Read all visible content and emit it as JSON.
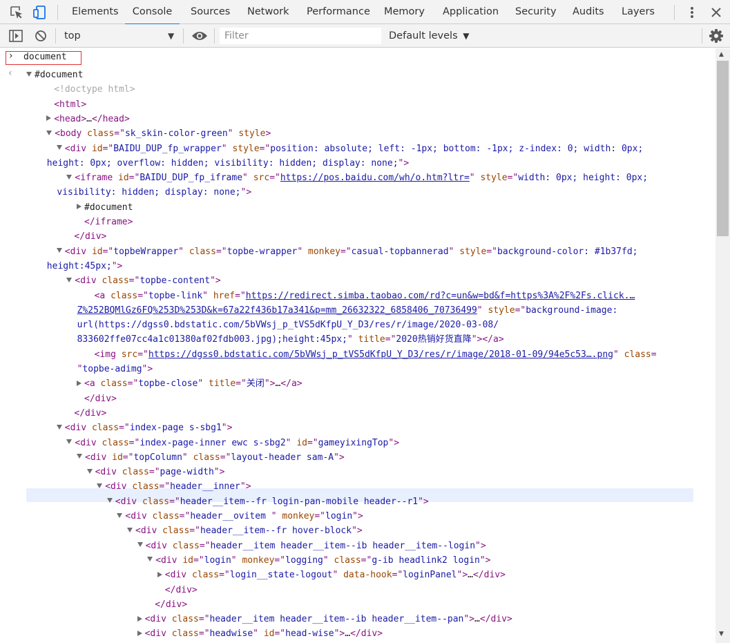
{
  "tabs": [
    {
      "label": "Elements",
      "active": false
    },
    {
      "label": "Console",
      "active": true
    },
    {
      "label": "Sources",
      "active": false
    },
    {
      "label": "Network",
      "active": false
    },
    {
      "label": "Performance",
      "active": false
    },
    {
      "label": "Memory",
      "active": false
    },
    {
      "label": "Application",
      "active": false
    },
    {
      "label": "Security",
      "active": false
    },
    {
      "label": "Audits",
      "active": false
    },
    {
      "label": "Layers",
      "active": false
    }
  ],
  "toolbar": {
    "context": "top",
    "filter_placeholder": "Filter",
    "levels": "Default levels"
  },
  "console": {
    "input": "document",
    "lines": [
      {
        "indent": 0,
        "tri": "down",
        "parts": [
          [
            "plain",
            "#document"
          ]
        ]
      },
      {
        "indent": 2,
        "tri": null,
        "parts": [
          [
            "comment",
            "<!doctype html>"
          ]
        ]
      },
      {
        "indent": 2,
        "tri": null,
        "parts": [
          [
            "tag",
            "<html>"
          ]
        ]
      },
      {
        "indent": 2,
        "tri": "right",
        "parts": [
          [
            "tag",
            "<head>"
          ],
          [
            "plain",
            "…"
          ],
          [
            "tag",
            "</head>"
          ]
        ]
      },
      {
        "indent": 2,
        "tri": "down",
        "parts": [
          [
            "tag",
            "<body "
          ],
          [
            "an",
            "class"
          ],
          [
            "tag",
            "=\""
          ],
          [
            "av",
            "sk_skin-color-green"
          ],
          [
            "tag",
            "\" "
          ],
          [
            "an",
            "style"
          ],
          [
            "tag",
            ">"
          ]
        ]
      },
      {
        "indent": 3,
        "tri": "down",
        "parts": [
          [
            "tag",
            "<div "
          ],
          [
            "an",
            "id"
          ],
          [
            "tag",
            "=\""
          ],
          [
            "av",
            "BAIDU_DUP_fp_wrapper"
          ],
          [
            "tag",
            "\" "
          ],
          [
            "an",
            "style"
          ],
          [
            "tag",
            "=\""
          ],
          [
            "av",
            "position: absolute; left: -1px; bottom: -1px; z-index: 0; width: 0px;"
          ]
        ]
      },
      {
        "indent": 3,
        "tri": null,
        "cont": true,
        "parts": [
          [
            "av",
            "height: 0px; overflow: hidden; visibility: hidden; display: none;"
          ],
          [
            "tag",
            "\">"
          ]
        ]
      },
      {
        "indent": 4,
        "tri": "down",
        "parts": [
          [
            "tag",
            "<iframe "
          ],
          [
            "an",
            "id"
          ],
          [
            "tag",
            "=\""
          ],
          [
            "av",
            "BAIDU_DUP_fp_iframe"
          ],
          [
            "tag",
            "\" "
          ],
          [
            "an",
            "src"
          ],
          [
            "tag",
            "=\""
          ],
          [
            "link",
            "https://pos.baidu.com/wh/o.htm?ltr="
          ],
          [
            "tag",
            "\" "
          ],
          [
            "an",
            "style"
          ],
          [
            "tag",
            "=\""
          ],
          [
            "av",
            "width: 0px; height: 0px;"
          ]
        ]
      },
      {
        "indent": 4,
        "tri": null,
        "cont": true,
        "parts": [
          [
            "av",
            "visibility: hidden; display: none;"
          ],
          [
            "tag",
            "\">"
          ]
        ]
      },
      {
        "indent": 5,
        "tri": "right",
        "parts": [
          [
            "plain",
            "#document"
          ]
        ]
      },
      {
        "indent": 5,
        "tri": null,
        "parts": [
          [
            "tag",
            "</iframe>"
          ]
        ]
      },
      {
        "indent": 4,
        "tri": null,
        "parts": [
          [
            "tag",
            "</div>"
          ]
        ]
      },
      {
        "indent": 3,
        "tri": "down",
        "parts": [
          [
            "tag",
            "<div "
          ],
          [
            "an",
            "id"
          ],
          [
            "tag",
            "=\""
          ],
          [
            "av",
            "topbeWrapper"
          ],
          [
            "tag",
            "\" "
          ],
          [
            "an",
            "class"
          ],
          [
            "tag",
            "=\""
          ],
          [
            "av",
            "topbe-wrapper"
          ],
          [
            "tag",
            "\" "
          ],
          [
            "an",
            "monkey"
          ],
          [
            "tag",
            "=\""
          ],
          [
            "av",
            "casual-topbannerad"
          ],
          [
            "tag",
            "\" "
          ],
          [
            "an",
            "style"
          ],
          [
            "tag",
            "=\""
          ],
          [
            "av",
            "background-color: #1b37fd;"
          ]
        ]
      },
      {
        "indent": 3,
        "tri": null,
        "cont": true,
        "parts": [
          [
            "av",
            "height:45px;"
          ],
          [
            "tag",
            "\">"
          ]
        ]
      },
      {
        "indent": 4,
        "tri": "down",
        "parts": [
          [
            "tag",
            "<div "
          ],
          [
            "an",
            "class"
          ],
          [
            "tag",
            "=\""
          ],
          [
            "av",
            "topbe-content"
          ],
          [
            "tag",
            "\">"
          ]
        ]
      },
      {
        "indent": 6,
        "tri": null,
        "parts": [
          [
            "tag",
            "<a "
          ],
          [
            "an",
            "class"
          ],
          [
            "tag",
            "=\""
          ],
          [
            "av",
            "topbe-link"
          ],
          [
            "tag",
            "\" "
          ],
          [
            "an",
            "href"
          ],
          [
            "tag",
            "=\""
          ],
          [
            "link",
            "https://redirect.simba.taobao.com/rd?c=un&w=bd&f=https%3A%2F%2Fs.click.…"
          ]
        ]
      },
      {
        "indent": 6,
        "tri": null,
        "cont": true,
        "parts": [
          [
            "link",
            "Z%252BQMlGz6FQ%253D%253D&k=67a22f436b17a341&p=mm_26632322_6858406_70736499"
          ],
          [
            "tag",
            "\" "
          ],
          [
            "an",
            "style"
          ],
          [
            "tag",
            "=\""
          ],
          [
            "av",
            "background-image:"
          ]
        ]
      },
      {
        "indent": 6,
        "tri": null,
        "cont": true,
        "parts": [
          [
            "av",
            "url(https://dgss0.bdstatic.com/5bVWsj_p_tVS5dKfpU_Y_D3/res/r/image/2020-03-08/"
          ]
        ]
      },
      {
        "indent": 6,
        "tri": null,
        "cont": true,
        "parts": [
          [
            "av",
            "833602ffe07cc4a1c01380af02fdb003.jpg);height:45px;"
          ],
          [
            "tag",
            "\" "
          ],
          [
            "an",
            "title"
          ],
          [
            "tag",
            "=\""
          ],
          [
            "av",
            "2020热销好货直降"
          ],
          [
            "tag",
            "\"></a>"
          ]
        ]
      },
      {
        "indent": 6,
        "tri": null,
        "parts": [
          [
            "tag",
            "<img "
          ],
          [
            "an",
            "src"
          ],
          [
            "tag",
            "=\""
          ],
          [
            "link",
            "https://dgss0.bdstatic.com/5bVWsj_p_tVS5dKfpU_Y_D3/res/r/image/2018-01-09/94e5c53….png"
          ],
          [
            "tag",
            "\" "
          ],
          [
            "an",
            "class"
          ],
          [
            "tag",
            "="
          ]
        ]
      },
      {
        "indent": 6,
        "tri": null,
        "cont": true,
        "parts": [
          [
            "tag",
            "\""
          ],
          [
            "av",
            "topbe-adimg"
          ],
          [
            "tag",
            "\">"
          ]
        ]
      },
      {
        "indent": 5,
        "tri": "right",
        "parts": [
          [
            "tag",
            "<a "
          ],
          [
            "an",
            "class"
          ],
          [
            "tag",
            "=\""
          ],
          [
            "av",
            "topbe-close"
          ],
          [
            "tag",
            "\" "
          ],
          [
            "an",
            "title"
          ],
          [
            "tag",
            "=\""
          ],
          [
            "av",
            "关闭"
          ],
          [
            "tag",
            "\">"
          ],
          [
            "plain",
            "…"
          ],
          [
            "tag",
            "</a>"
          ]
        ]
      },
      {
        "indent": 5,
        "tri": null,
        "parts": [
          [
            "tag",
            "</div>"
          ]
        ]
      },
      {
        "indent": 4,
        "tri": null,
        "parts": [
          [
            "tag",
            "</div>"
          ]
        ]
      },
      {
        "indent": 3,
        "tri": "down",
        "parts": [
          [
            "tag",
            "<div "
          ],
          [
            "an",
            "class"
          ],
          [
            "tag",
            "=\""
          ],
          [
            "av",
            "index-page s-sbg1"
          ],
          [
            "tag",
            "\">"
          ]
        ]
      },
      {
        "indent": 4,
        "tri": "down",
        "parts": [
          [
            "tag",
            "<div "
          ],
          [
            "an",
            "class"
          ],
          [
            "tag",
            "=\""
          ],
          [
            "av",
            "index-page-inner ewc s-sbg2"
          ],
          [
            "tag",
            "\" "
          ],
          [
            "an",
            "id"
          ],
          [
            "tag",
            "=\""
          ],
          [
            "av",
            "gameyixingTop"
          ],
          [
            "tag",
            "\">"
          ]
        ]
      },
      {
        "indent": 5,
        "tri": "down",
        "parts": [
          [
            "tag",
            "<div "
          ],
          [
            "an",
            "id"
          ],
          [
            "tag",
            "=\""
          ],
          [
            "av",
            "topColumn"
          ],
          [
            "tag",
            "\" "
          ],
          [
            "an",
            "class"
          ],
          [
            "tag",
            "=\""
          ],
          [
            "av",
            "layout-header sam-A"
          ],
          [
            "tag",
            "\">"
          ]
        ]
      },
      {
        "indent": 6,
        "tri": "down",
        "parts": [
          [
            "tag",
            "<div "
          ],
          [
            "an",
            "class"
          ],
          [
            "tag",
            "=\""
          ],
          [
            "av",
            "page-width"
          ],
          [
            "tag",
            "\">"
          ]
        ]
      },
      {
        "indent": 7,
        "tri": "down",
        "parts": [
          [
            "tag",
            "<div "
          ],
          [
            "an",
            "class"
          ],
          [
            "tag",
            "=\""
          ],
          [
            "av",
            "header__inner"
          ],
          [
            "tag",
            "\">"
          ]
        ]
      },
      {
        "indent": 8,
        "tri": "down",
        "highlight": true,
        "parts": [
          [
            "tag",
            "<div "
          ],
          [
            "an",
            "class"
          ],
          [
            "tag",
            "=\""
          ],
          [
            "av",
            "header__item--fr login-pan-mobile header--r1"
          ],
          [
            "tag",
            "\">"
          ]
        ]
      },
      {
        "indent": 9,
        "tri": "down",
        "parts": [
          [
            "tag",
            "<div "
          ],
          [
            "an",
            "class"
          ],
          [
            "tag",
            "=\""
          ],
          [
            "av",
            "header__ovitem "
          ],
          [
            "tag",
            "\" "
          ],
          [
            "an",
            "monkey"
          ],
          [
            "tag",
            "=\""
          ],
          [
            "av",
            "login"
          ],
          [
            "tag",
            "\">"
          ]
        ]
      },
      {
        "indent": 10,
        "tri": "down",
        "parts": [
          [
            "tag",
            "<div "
          ],
          [
            "an",
            "class"
          ],
          [
            "tag",
            "=\""
          ],
          [
            "av",
            "header__item--fr hover-block"
          ],
          [
            "tag",
            "\">"
          ]
        ]
      },
      {
        "indent": 11,
        "tri": "down",
        "parts": [
          [
            "tag",
            "<div "
          ],
          [
            "an",
            "class"
          ],
          [
            "tag",
            "=\""
          ],
          [
            "av",
            "header__item header__item--ib header__item--login"
          ],
          [
            "tag",
            "\">"
          ]
        ]
      },
      {
        "indent": 12,
        "tri": "down",
        "parts": [
          [
            "tag",
            "<div "
          ],
          [
            "an",
            "id"
          ],
          [
            "tag",
            "=\""
          ],
          [
            "av",
            "login"
          ],
          [
            "tag",
            "\" "
          ],
          [
            "an",
            "monkey"
          ],
          [
            "tag",
            "=\""
          ],
          [
            "av",
            "logging"
          ],
          [
            "tag",
            "\" "
          ],
          [
            "an",
            "class"
          ],
          [
            "tag",
            "=\""
          ],
          [
            "av",
            "g-ib headlink2 login"
          ],
          [
            "tag",
            "\">"
          ]
        ]
      },
      {
        "indent": 13,
        "tri": "right",
        "parts": [
          [
            "tag",
            "<div "
          ],
          [
            "an",
            "class"
          ],
          [
            "tag",
            "=\""
          ],
          [
            "av",
            "login__state-logout"
          ],
          [
            "tag",
            "\" "
          ],
          [
            "an",
            "data-hook"
          ],
          [
            "tag",
            "=\""
          ],
          [
            "av",
            "loginPanel"
          ],
          [
            "tag",
            "\">"
          ],
          [
            "plain",
            "…"
          ],
          [
            "tag",
            "</div>"
          ]
        ]
      },
      {
        "indent": 13,
        "tri": null,
        "parts": [
          [
            "tag",
            "</div>"
          ]
        ]
      },
      {
        "indent": 12,
        "tri": null,
        "parts": [
          [
            "tag",
            "</div>"
          ]
        ]
      },
      {
        "indent": 11,
        "tri": "right",
        "parts": [
          [
            "tag",
            "<div "
          ],
          [
            "an",
            "class"
          ],
          [
            "tag",
            "=\""
          ],
          [
            "av",
            "header__item header__item--ib header__item--pan"
          ],
          [
            "tag",
            "\">"
          ],
          [
            "plain",
            "…"
          ],
          [
            "tag",
            "</div>"
          ]
        ]
      },
      {
        "indent": 11,
        "tri": "right",
        "parts": [
          [
            "tag",
            "<div "
          ],
          [
            "an",
            "class"
          ],
          [
            "tag",
            "=\""
          ],
          [
            "av",
            "headwise"
          ],
          [
            "tag",
            "\" "
          ],
          [
            "an",
            "id"
          ],
          [
            "tag",
            "=\""
          ],
          [
            "av",
            "head-wise"
          ],
          [
            "tag",
            "\">"
          ],
          [
            "plain",
            "…"
          ],
          [
            "tag",
            "</div>"
          ]
        ]
      },
      {
        "indent": 11,
        "tri": null,
        "parts": [
          [
            "tag",
            "</div>"
          ]
        ]
      }
    ]
  },
  "colors": {
    "tag": "#881280",
    "attr_name": "#994500",
    "attr_value": "#1a1aa6",
    "active_tab_underline": "#1a73e8",
    "highlight_row": "#e8f0fe",
    "input_border": "#e03030"
  },
  "icons": [
    "inspect-icon",
    "device-toolbar-icon",
    "sidebar-toggle-icon",
    "clear-console-icon",
    "eye-icon",
    "more-vert-icon",
    "close-icon",
    "settings-gear-icon"
  ]
}
